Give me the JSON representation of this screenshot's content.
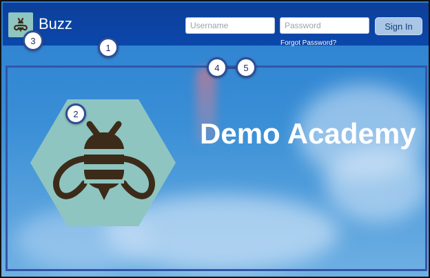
{
  "header": {
    "brand": "Buzz",
    "username_placeholder": "Username",
    "password_placeholder": "Password",
    "signin_label": "Sign In",
    "forgot_label": "Forgot Password?"
  },
  "banner": {
    "title": "Demo Academy"
  },
  "callouts": [
    "1",
    "2",
    "3",
    "4",
    "5"
  ],
  "colors": {
    "header": "#0b47ab",
    "logo_bg": "#8ec5c0",
    "banner_border": "#3356a8",
    "bee": "#3d2b1a"
  },
  "icons": {
    "logo": "bee-icon",
    "banner_logo": "bee-hexagon-icon"
  }
}
